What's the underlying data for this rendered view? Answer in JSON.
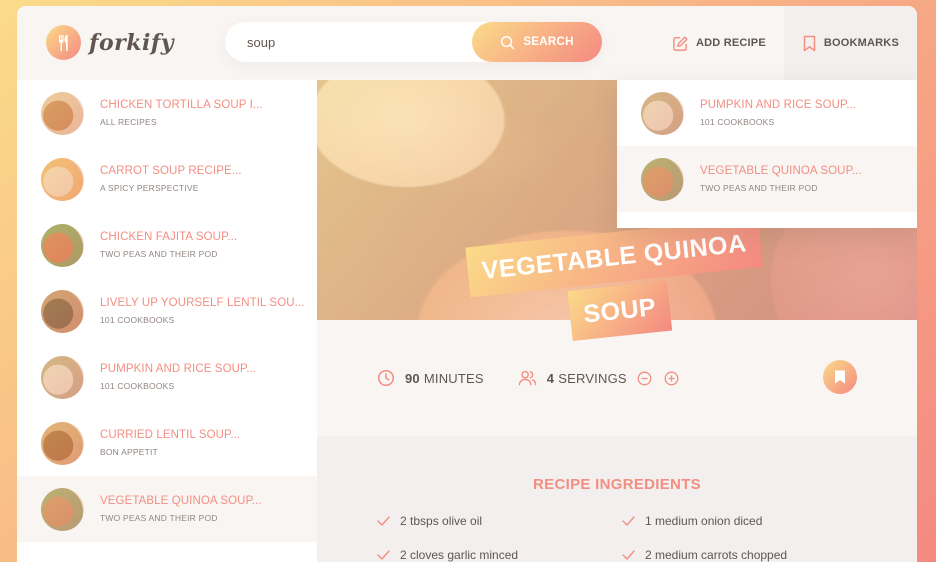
{
  "app": {
    "name": "forkify"
  },
  "search": {
    "value": "soup",
    "button_label": "SEARCH"
  },
  "nav": {
    "add_recipe": "ADD RECIPE",
    "bookmarks": "BOOKMARKS"
  },
  "results": [
    {
      "title": "CHICKEN TORTILLA SOUP I...",
      "publisher": "ALL RECIPES",
      "colors": [
        "#c9884f",
        "#e7c7a2"
      ]
    },
    {
      "title": "CARROT SOUP RECIPE...",
      "publisher": "A SPICY PERSPECTIVE",
      "colors": [
        "#f2d8b4",
        "#efb56c"
      ]
    },
    {
      "title": "CHICKEN FAJITA SOUP...",
      "publisher": "TWO PEAS AND THEIR POD",
      "colors": [
        "#d27a4c",
        "#8ea05a"
      ]
    },
    {
      "title": "LIVELY UP YOURSELF LENTIL SOU...",
      "publisher": "101 COOKBOOKS",
      "colors": [
        "#7a5a3c",
        "#c29068"
      ]
    },
    {
      "title": "PUMPKIN AND RICE SOUP...",
      "publisher": "101 COOKBOOKS",
      "colors": [
        "#e9d6c2",
        "#c7a884"
      ]
    },
    {
      "title": "CURRIED LENTIL SOUP...",
      "publisher": "BON APPETIT",
      "colors": [
        "#a86834",
        "#d8a470"
      ]
    },
    {
      "title": "VEGETABLE QUINOA SOUP...",
      "publisher": "TWO PEAS AND THEIR POD",
      "colors": [
        "#cf8b5e",
        "#a0a06a"
      ]
    }
  ],
  "bookmarks": [
    {
      "title": "PUMPKIN AND RICE SOUP...",
      "publisher": "101 COOKBOOKS",
      "colors": [
        "#e9d6c2",
        "#c7a884"
      ]
    },
    {
      "title": "VEGETABLE QUINOA SOUP...",
      "publisher": "TWO PEAS AND THEIR POD",
      "colors": [
        "#cf8b5e",
        "#a0a06a"
      ]
    }
  ],
  "recipe": {
    "title_line1": "VEGETABLE QUINOA",
    "title_line2": "SOUP",
    "cooking_time": "90",
    "time_unit": "MINUTES",
    "servings": "4",
    "servings_unit": "SERVINGS",
    "ingredients_heading": "RECIPE INGREDIENTS",
    "ingredients": [
      "2 tbsps olive oil",
      "1 medium onion diced",
      "2 cloves garlic minced",
      "2 medium carrots chopped"
    ]
  },
  "colors": {
    "accent": "#f38e82",
    "gradient_start": "#fbdb89",
    "gradient_end": "#f48982",
    "text": "#615551"
  }
}
